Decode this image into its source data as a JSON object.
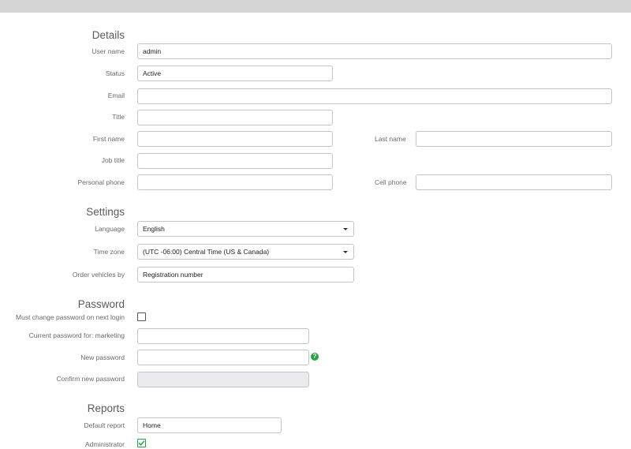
{
  "sections": {
    "details": "Details",
    "settings": "Settings",
    "password": "Password",
    "reports": "Reports"
  },
  "details": {
    "username_label": "User name",
    "username_value": "admin",
    "status_label": "Status",
    "status_value": "Active",
    "email_label": "Email",
    "email_value": "",
    "title_label": "Title",
    "title_value": "",
    "first_name_label": "First name",
    "first_name_value": "",
    "last_name_label": "Last name",
    "last_name_value": "",
    "job_title_label": "Job title",
    "job_title_value": "",
    "personal_phone_label": "Personal phone",
    "personal_phone_value": "",
    "cell_phone_label": "Cell phone",
    "cell_phone_value": ""
  },
  "settings": {
    "language_label": "Language",
    "language_value": "English",
    "timezone_label": "Time zone",
    "timezone_value": "(UTC -06:00) Central Time (US & Canada)",
    "order_label": "Order vehicles by",
    "order_value": "Registration number"
  },
  "password": {
    "must_change_label": "Must change password on next login",
    "must_change_checked": false,
    "current_label": "Current password for: marketing",
    "new_label": "New password",
    "help_icon": "question-mark-icon",
    "help_color": "#27a345",
    "confirm_label": "Confirm new password"
  },
  "reports": {
    "default_report_label": "Default report",
    "default_report_value": "Home",
    "administrator_label": "Administrator",
    "administrator_checked": true,
    "check_color": "#27a345"
  }
}
